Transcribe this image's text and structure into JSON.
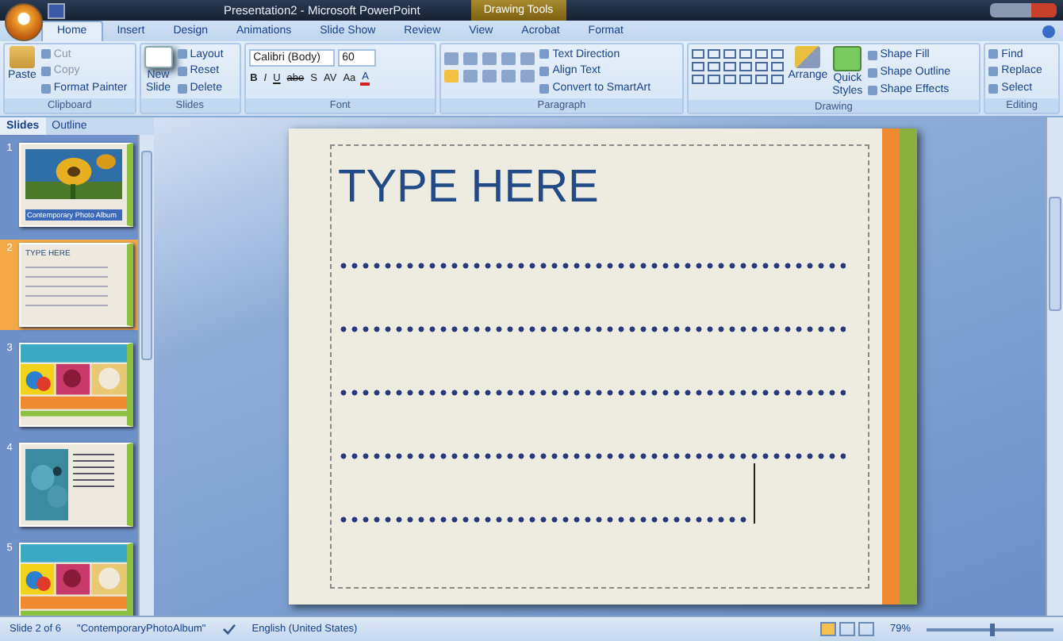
{
  "window": {
    "title": "Presentation2 - Microsoft PowerPoint",
    "context_label": "Drawing Tools"
  },
  "tabs": [
    {
      "label": "Home",
      "selected": true
    },
    {
      "label": "Insert",
      "selected": false
    },
    {
      "label": "Design",
      "selected": false
    },
    {
      "label": "Animations",
      "selected": false
    },
    {
      "label": "Slide Show",
      "selected": false
    },
    {
      "label": "Review",
      "selected": false
    },
    {
      "label": "View",
      "selected": false
    },
    {
      "label": "Acrobat",
      "selected": false
    },
    {
      "label": "Format",
      "selected": false
    }
  ],
  "ribbon": {
    "clipboard": {
      "label": "Clipboard",
      "paste": "Paste",
      "items": [
        {
          "label": "Cut",
          "disabled": true
        },
        {
          "label": "Copy",
          "disabled": true
        },
        {
          "label": "Format Painter",
          "disabled": false
        }
      ]
    },
    "slides": {
      "label": "Slides",
      "new_slide": [
        "New",
        "Slide"
      ],
      "items": [
        "Layout",
        "Reset",
        "Delete"
      ]
    },
    "font": {
      "label": "Font",
      "family": "Calibri (Body)",
      "size": "60",
      "buttons": [
        "B",
        "I",
        "U",
        "abe",
        "S",
        "AV",
        "Aa",
        "A"
      ]
    },
    "paragraph": {
      "label": "Paragraph",
      "items": [
        "Text Direction",
        "Align Text",
        "Convert to SmartArt"
      ]
    },
    "drawing": {
      "label": "Drawing",
      "arrange": "Arrange",
      "quick_styles": [
        "Quick",
        "Styles"
      ],
      "items": [
        "Shape Fill",
        "Shape Outline",
        "Shape Effects"
      ]
    },
    "editing": {
      "label": "Editing",
      "items": [
        "Find",
        "Replace",
        "Select"
      ]
    }
  },
  "pane": {
    "tabs": [
      {
        "label": "Slides",
        "selected": true
      },
      {
        "label": "Outline",
        "selected": false
      }
    ],
    "thumbnails": [
      {
        "number": "1",
        "kind": "title",
        "caption": "Contemporary Photo Album",
        "selected": false
      },
      {
        "number": "2",
        "kind": "text",
        "title": "TYPE HERE",
        "selected": true
      },
      {
        "number": "3",
        "kind": "photos",
        "selected": false
      },
      {
        "number": "4",
        "kind": "photo_text",
        "selected": false
      },
      {
        "number": "5",
        "kind": "photos",
        "selected": false
      }
    ]
  },
  "slide": {
    "title": "TYPE HERE",
    "dotted_lines": [
      {
        "cursor": false
      },
      {
        "cursor": false
      },
      {
        "cursor": false
      },
      {
        "cursor": false
      },
      {
        "cursor": true
      }
    ]
  },
  "status_bar": {
    "slide": "Slide 2 of 6",
    "theme": "\"ContemporaryPhotoAlbum\"",
    "language": "English (United States)",
    "zoom": "79%",
    "zoom_slider": {
      "level": 0.5
    }
  }
}
